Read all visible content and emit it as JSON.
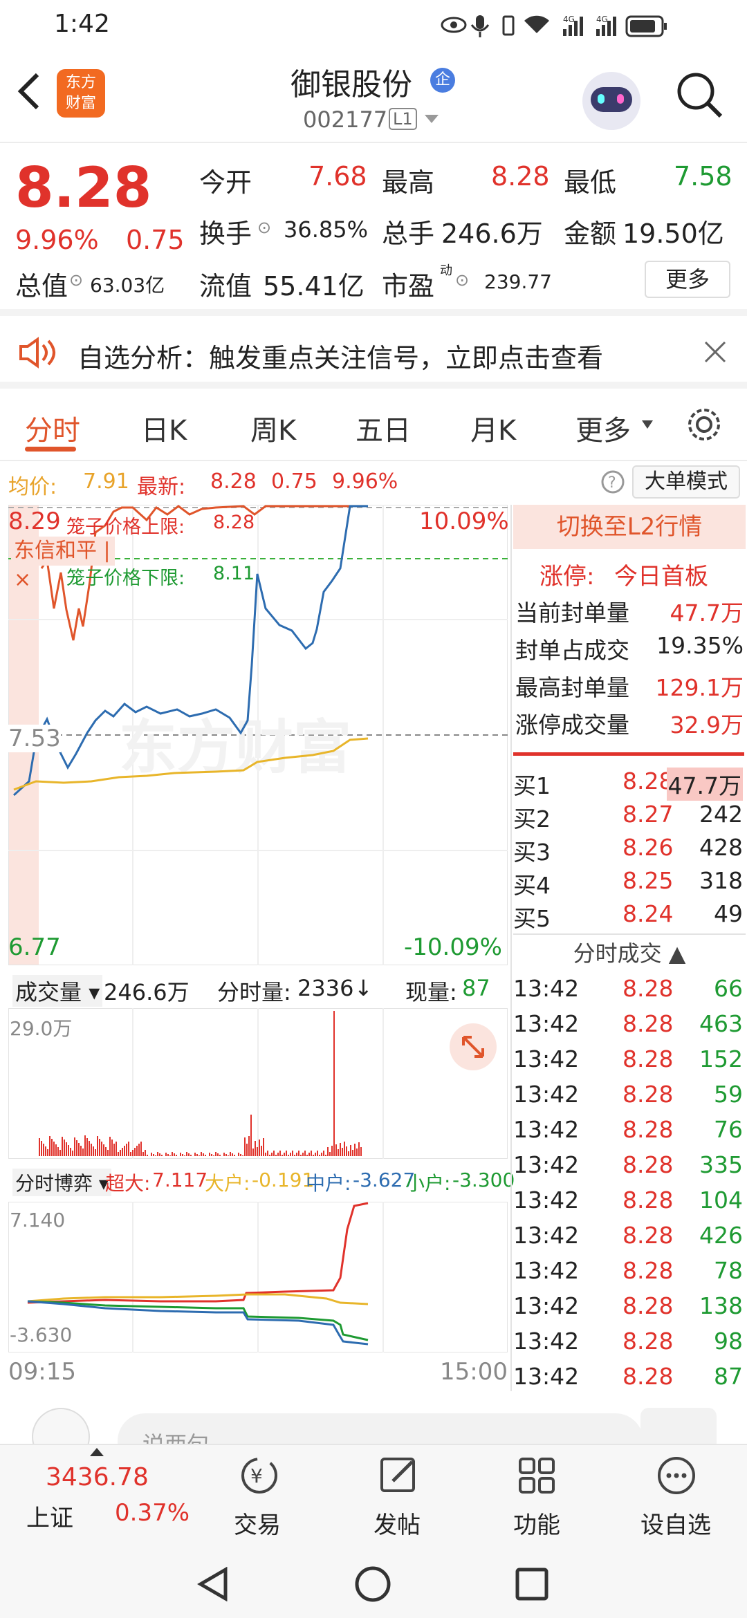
{
  "status": {
    "time": "1:42",
    "sig1": "4G",
    "sig2": "4G"
  },
  "header": {
    "logo_line1": "东方",
    "logo_line2": "财富",
    "stock_name": "御银股份",
    "badge": "企",
    "code": "002177",
    "level": "L1"
  },
  "quote": {
    "price": "8.28",
    "change_pct": "9.96%",
    "change_amt": "0.75",
    "open_label": "今开",
    "open": "7.68",
    "high_label": "最高",
    "high": "8.28",
    "low_label": "最低",
    "low": "7.58",
    "turnover_label": "换手",
    "turnover": "36.85%",
    "vol_label": "总手",
    "vol": "246.6万",
    "amount_label": "金额",
    "amount": "19.50亿",
    "mcap_label": "总值",
    "mcap": "63.03亿",
    "float_label": "流值",
    "float": "55.41亿",
    "pe_label": "市盈",
    "pe_sup": "动",
    "pe": "239.77",
    "more": "更多"
  },
  "alert": {
    "text": "自选分析：触发重点关注信号，立即点击查看"
  },
  "tabs": [
    "分时",
    "日K",
    "周K",
    "五日",
    "月K",
    "更多"
  ],
  "info_bar": {
    "avg_label": "均价:",
    "avg": "7.91",
    "latest_label": "最新:",
    "latest": "8.28",
    "chg": "0.75",
    "pct": "9.96%",
    "mode_btn": "大单模式"
  },
  "chart": {
    "y_high": "8.29",
    "y_mid": "7.53",
    "y_low": "6.77",
    "pct_high": "10.09%",
    "pct_low": "-10.09%",
    "cage_up_label": "笼子价格上限:",
    "cage_up": "8.28",
    "cage_down_label": "笼子价格下限:",
    "cage_down": "8.11",
    "broker": "东信和平",
    "watermark": "东方财富",
    "time_start": "09:15",
    "time_end": "15:00"
  },
  "volume": {
    "label": "成交量",
    "total": "246.6万",
    "min_vol_label": "分时量:",
    "min_vol": "2336",
    "arrow": "↓",
    "now_label": "现量:",
    "now": "87",
    "axis_max": "29.0万"
  },
  "game": {
    "label": "分时博弈",
    "super_label": "超大:",
    "super": "7.117",
    "large_label": "大户:",
    "large": "-0.191",
    "mid_label": "中户:",
    "mid": "-3.627",
    "small_label": "小户:",
    "small": "-3.300",
    "axis_max": "7.140",
    "axis_min": "-3.630"
  },
  "panel": {
    "switch_l2": "切换至L2行情",
    "limit_label": "涨停:",
    "limit_text": "今日首板",
    "stats": [
      {
        "label": "当前封单量",
        "value": "47.7万"
      },
      {
        "label": "封单占成交",
        "value": "19.35%"
      },
      {
        "label": "最高封单量",
        "value": "129.1万"
      },
      {
        "label": "涨停成交量",
        "value": "32.9万"
      }
    ],
    "bids": [
      {
        "label": "买1",
        "price": "8.28",
        "qty": "47.7万"
      },
      {
        "label": "买2",
        "price": "8.27",
        "qty": "242"
      },
      {
        "label": "买3",
        "price": "8.26",
        "qty": "428"
      },
      {
        "label": "买4",
        "price": "8.25",
        "qty": "318"
      },
      {
        "label": "买5",
        "price": "8.24",
        "qty": "49"
      }
    ],
    "trades_title": "分时成交",
    "trades": [
      {
        "t": "13:42",
        "p": "8.28",
        "q": "66"
      },
      {
        "t": "13:42",
        "p": "8.28",
        "q": "463"
      },
      {
        "t": "13:42",
        "p": "8.28",
        "q": "152"
      },
      {
        "t": "13:42",
        "p": "8.28",
        "q": "59"
      },
      {
        "t": "13:42",
        "p": "8.28",
        "q": "76"
      },
      {
        "t": "13:42",
        "p": "8.28",
        "q": "335"
      },
      {
        "t": "13:42",
        "p": "8.28",
        "q": "104"
      },
      {
        "t": "13:42",
        "p": "8.28",
        "q": "426"
      },
      {
        "t": "13:42",
        "p": "8.28",
        "q": "78"
      },
      {
        "t": "13:42",
        "p": "8.28",
        "q": "138"
      },
      {
        "t": "13:42",
        "p": "8.28",
        "q": "98"
      },
      {
        "t": "13:42",
        "p": "8.28",
        "q": "87"
      }
    ]
  },
  "comment_bar": {
    "placeholder": "说两句..."
  },
  "bottom": {
    "index_value": "3436.78",
    "index_name": "上证",
    "index_pct": "0.37%",
    "trade": "交易",
    "post": "发帖",
    "func": "功能",
    "watch": "设自选"
  },
  "colors": {
    "up": "#e0322b",
    "down": "#1e9a32",
    "accent": "#e0552b",
    "avg_line": "#e8b52a",
    "price_line": "#2d6cb0"
  }
}
